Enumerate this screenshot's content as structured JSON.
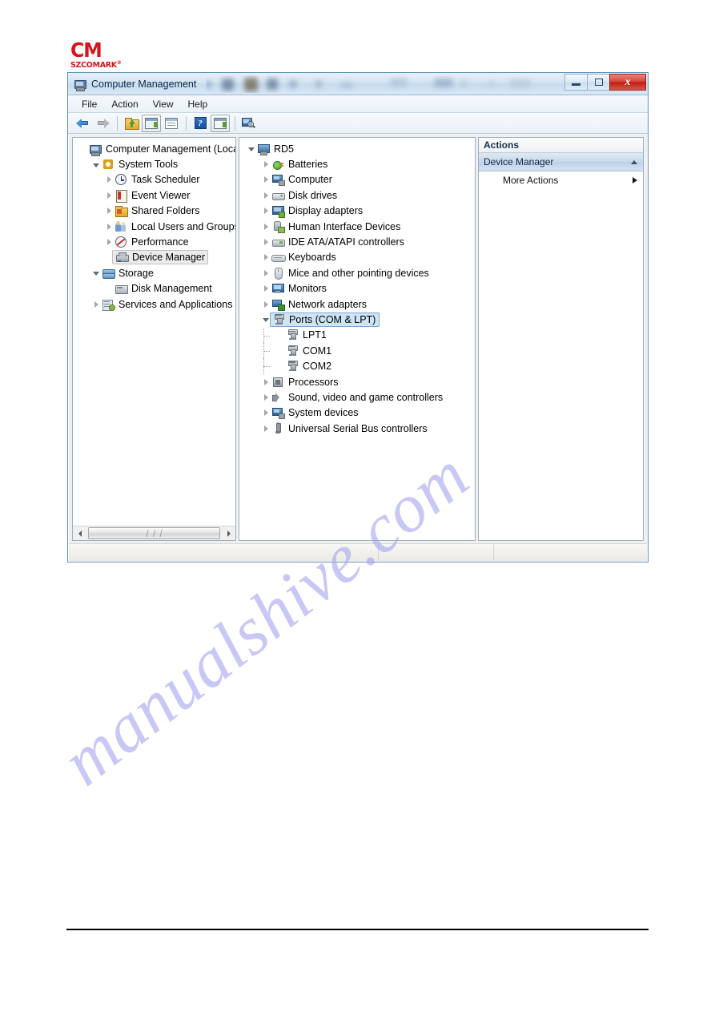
{
  "logo": {
    "mark": "CM",
    "name": "SZCOMARK",
    "registered": "®"
  },
  "watermark": {
    "text": "manualshive.com"
  },
  "window": {
    "title": "Computer Management",
    "icon": "computer-management-icon",
    "controls": {
      "minimize": "–",
      "maximize": "□",
      "close": "x"
    }
  },
  "menubar": {
    "items": [
      {
        "label": "File"
      },
      {
        "label": "Action"
      },
      {
        "label": "View"
      },
      {
        "label": "Help"
      }
    ]
  },
  "toolbar": {
    "buttons": [
      {
        "name": "back-icon",
        "title": "Back"
      },
      {
        "name": "forward-icon",
        "title": "Forward"
      },
      {
        "name": "up-one-level-icon",
        "title": "Up One Level"
      },
      {
        "name": "show-hide-console-tree-icon",
        "title": "Show/Hide Console Tree"
      },
      {
        "name": "properties-icon",
        "title": "Properties"
      },
      {
        "name": "help-icon",
        "title": "Help"
      },
      {
        "name": "show-hide-action-pane-icon",
        "title": "Show/Hide Action Pane"
      },
      {
        "name": "scan-for-hardware-changes-icon",
        "title": "Scan for hardware changes"
      }
    ]
  },
  "console_tree": {
    "items": [
      {
        "label": "Computer Management (Local",
        "depth": 0,
        "twisty": "none",
        "icon": "mmc-icon",
        "selected": false
      },
      {
        "label": "System Tools",
        "depth": 1,
        "twisty": "expanded",
        "icon": "gear-icon",
        "selected": false
      },
      {
        "label": "Task Scheduler",
        "depth": 2,
        "twisty": "collapsed",
        "icon": "clock-icon",
        "selected": false
      },
      {
        "label": "Event Viewer",
        "depth": 2,
        "twisty": "collapsed",
        "icon": "log-icon",
        "selected": false
      },
      {
        "label": "Shared Folders",
        "depth": 2,
        "twisty": "collapsed",
        "icon": "folder-icon",
        "selected": false
      },
      {
        "label": "Local Users and Groups",
        "depth": 2,
        "twisty": "collapsed",
        "icon": "users-icon",
        "selected": false
      },
      {
        "label": "Performance",
        "depth": 2,
        "twisty": "collapsed",
        "icon": "perf-icon",
        "selected": false
      },
      {
        "label": "Device Manager",
        "depth": 2,
        "twisty": "none",
        "icon": "dm-icon",
        "selected": true
      },
      {
        "label": "Storage",
        "depth": 1,
        "twisty": "expanded",
        "icon": "storage-icon",
        "selected": false
      },
      {
        "label": "Disk Management",
        "depth": 2,
        "twisty": "none",
        "icon": "disk-icon",
        "selected": false
      },
      {
        "label": "Services and Applications",
        "depth": 1,
        "twisty": "collapsed",
        "icon": "svc-icon",
        "selected": false
      }
    ],
    "scrollbar": {
      "grip": "❘❘❘"
    }
  },
  "device_tree": {
    "items": [
      {
        "label": "RD5",
        "depth": 0,
        "twisty": "expanded",
        "icon": "pc-icon",
        "selected": false
      },
      {
        "label": "Batteries",
        "depth": 1,
        "twisty": "collapsed",
        "icon": "batt-icon",
        "selected": false
      },
      {
        "label": "Computer",
        "depth": 1,
        "twisty": "collapsed",
        "icon": "sysd-icon",
        "selected": false
      },
      {
        "label": "Disk drives",
        "depth": 1,
        "twisty": "collapsed",
        "icon": "drive-icon",
        "selected": false
      },
      {
        "label": "Display adapters",
        "depth": 1,
        "twisty": "collapsed",
        "icon": "display-icon",
        "selected": false
      },
      {
        "label": "Human Interface Devices",
        "depth": 1,
        "twisty": "collapsed",
        "icon": "hid-icon",
        "selected": false
      },
      {
        "label": "IDE ATA/ATAPI controllers",
        "depth": 1,
        "twisty": "collapsed",
        "icon": "ide-icon",
        "selected": false
      },
      {
        "label": "Keyboards",
        "depth": 1,
        "twisty": "collapsed",
        "icon": "kbd-icon",
        "selected": false
      },
      {
        "label": "Mice and other pointing devices",
        "depth": 1,
        "twisty": "collapsed",
        "icon": "mouse-icon",
        "selected": false
      },
      {
        "label": "Monitors",
        "depth": 1,
        "twisty": "collapsed",
        "icon": "mon-icon",
        "selected": false
      },
      {
        "label": "Network adapters",
        "depth": 1,
        "twisty": "collapsed",
        "icon": "net-icon",
        "selected": false
      },
      {
        "label": "Ports (COM & LPT)",
        "depth": 1,
        "twisty": "expanded",
        "icon": "port-icon",
        "selected": true
      },
      {
        "label": "LPT1",
        "depth": 2,
        "twisty": "none",
        "icon": "port-icon",
        "selected": false
      },
      {
        "label": "COM1",
        "depth": 2,
        "twisty": "none",
        "icon": "port-icon",
        "selected": false
      },
      {
        "label": "COM2",
        "depth": 2,
        "twisty": "none",
        "icon": "port-icon",
        "selected": false
      },
      {
        "label": "Processors",
        "depth": 1,
        "twisty": "collapsed",
        "icon": "proc-icon",
        "selected": false
      },
      {
        "label": "Sound, video and game controllers",
        "depth": 1,
        "twisty": "collapsed",
        "icon": "snd-icon",
        "selected": false
      },
      {
        "label": "System devices",
        "depth": 1,
        "twisty": "collapsed",
        "icon": "sysd-icon",
        "selected": false
      },
      {
        "label": "Universal Serial Bus controllers",
        "depth": 1,
        "twisty": "collapsed",
        "icon": "usb-icon",
        "selected": false
      }
    ]
  },
  "actions_pane": {
    "header": "Actions",
    "group": {
      "label": "Device Manager",
      "caret": "collapse-caret-icon"
    },
    "items": [
      {
        "label": "More Actions",
        "caret": "submenu-caret-icon"
      }
    ]
  },
  "statusbar": {
    "cells": [
      "",
      "",
      ""
    ]
  }
}
